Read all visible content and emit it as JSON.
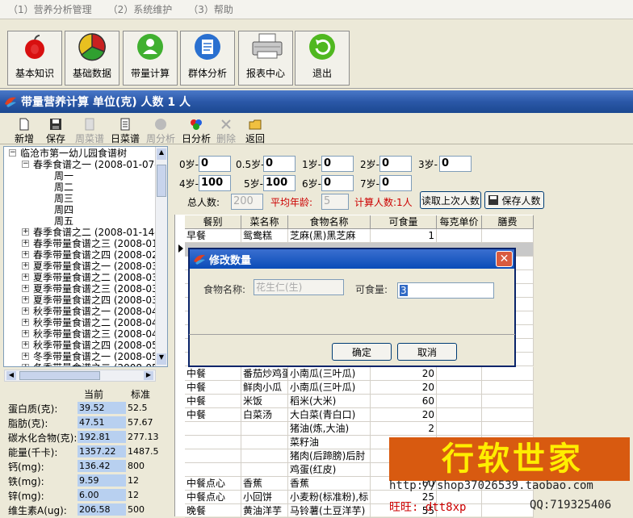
{
  "menu": [
    "（1）营养分析管理",
    "（2）系统维护",
    "（3）帮助"
  ],
  "big_toolbar": [
    {
      "label": "基本知识",
      "icon": "apple-icon"
    },
    {
      "label": "基础数据",
      "icon": "pie-chart-icon"
    },
    {
      "label": "带量计算",
      "icon": "user-icon"
    },
    {
      "label": "群体分析",
      "icon": "document-icon"
    },
    {
      "label": "报表中心",
      "icon": "printer-icon"
    },
    {
      "label": "退出",
      "icon": "refresh-exit-icon"
    }
  ],
  "window_title": "带量营养计算  单位(克)  人数 1 人",
  "small_toolbar": [
    {
      "label": "新增",
      "enabled": true
    },
    {
      "label": "保存",
      "enabled": true
    },
    {
      "label": "周菜谱",
      "enabled": false
    },
    {
      "label": "日菜谱",
      "enabled": true
    },
    {
      "label": "周分析",
      "enabled": false
    },
    {
      "label": "日分析",
      "enabled": true
    },
    {
      "label": "删除",
      "enabled": false
    },
    {
      "label": "返回",
      "enabled": true
    }
  ],
  "tree": {
    "root": "临沧市第一幼儿园食谱树",
    "expanded": "春季食谱之一 (2008-01-07-",
    "days": [
      "周一",
      "周二",
      "周三",
      "周四",
      "周五"
    ],
    "items": [
      "春季食谱之二 (2008-01-14-",
      "春季带量食谱之三 (2008-01",
      "春季带量食谱之四 (2008-02",
      "夏季带量食谱之一 (2008-03",
      "夏季带量食谱之二 (2008-03",
      "夏季带量食谱之三 (2008-03",
      "夏季带量食谱之四 (2008-03",
      "秋季带量食谱之一 (2008-04",
      "秋季带量食谱之二 (2008-04",
      "秋季带量食谱之三 (2008-04",
      "秋季带量食谱之四 (2008-05",
      "冬季带量食谱之一 (2008-05",
      "冬季带量食谱之二 (2008-05"
    ]
  },
  "nutrients": {
    "col_current": "当前",
    "col_standard": "标准",
    "rows": [
      {
        "name": "蛋白质(克):",
        "current": "39.52",
        "standard": "52.5"
      },
      {
        "name": "脂肪(克):",
        "current": "47.51",
        "standard": "57.67"
      },
      {
        "name": "碳水化合物(克):",
        "current": "192.81",
        "standard": "277.13"
      },
      {
        "name": "能量(千卡):",
        "current": "1357.22",
        "standard": "1487.5"
      },
      {
        "name": "钙(mg):",
        "current": "136.42",
        "standard": "800"
      },
      {
        "name": "铁(mg):",
        "current": "9.59",
        "standard": "12"
      },
      {
        "name": "锌(mg):",
        "current": "6.00",
        "standard": "12"
      },
      {
        "name": "维生素A(ug):",
        "current": "206.58",
        "standard": "500"
      }
    ]
  },
  "ages": {
    "row1": [
      {
        "label": "0岁-",
        "value": "0"
      },
      {
        "label": "0.5岁-",
        "value": "0"
      },
      {
        "label": "1岁-",
        "value": "0"
      },
      {
        "label": "2岁-",
        "value": "0"
      },
      {
        "label": "3岁-",
        "value": "0"
      }
    ],
    "row2": [
      {
        "label": "4岁-",
        "value": "100"
      },
      {
        "label": "5岁-",
        "value": "100"
      },
      {
        "label": "6岁-",
        "value": "0"
      },
      {
        "label": "7岁-",
        "value": "0"
      }
    ]
  },
  "summary": {
    "total_label": "总人数:",
    "total_value": "200",
    "avg_age_label": "平均年龄:",
    "avg_age_value": "5",
    "calc_label": "计算人数:1人",
    "read_button": "读取上次人数",
    "save_button": "保存人数"
  },
  "grid": {
    "headers": [
      "餐别",
      "菜名称",
      "食物名称",
      "可食量",
      "每克单价",
      "膳费"
    ],
    "rows_top": [
      {
        "meal": "早餐",
        "dish": "鸳鸯糕",
        "food": "芝麻(黑)黑芝麻",
        "amount": "1"
      }
    ],
    "rows_bottom": [
      {
        "meal": "中餐",
        "dish": "番茄炒鸡蛋",
        "food": "小南瓜(三叶瓜)",
        "amount": "20"
      },
      {
        "meal": "中餐",
        "dish": "鲜肉小瓜",
        "food": "小南瓜(三叶瓜)",
        "amount": "20"
      },
      {
        "meal": "中餐",
        "dish": "米饭",
        "food": "稻米(大米)",
        "amount": "60"
      },
      {
        "meal": "中餐",
        "dish": "白菜汤",
        "food": "大白菜(青白口)",
        "amount": "20"
      },
      {
        "meal": "",
        "dish": "",
        "food": "猪油(炼,大油)",
        "amount": "2"
      },
      {
        "meal": "",
        "dish": "",
        "food": "菜籽油",
        "amount": ""
      },
      {
        "meal": "",
        "dish": "",
        "food": "猪肉(后蹄膀)后肘",
        "amount": ""
      },
      {
        "meal": "",
        "dish": "",
        "food": "鸡蛋(红皮)",
        "amount": ""
      },
      {
        "meal": "中餐点心",
        "dish": "香蕉",
        "food": "香蕉",
        "amount": "60"
      },
      {
        "meal": "中餐点心",
        "dish": "小回饼",
        "food": "小麦粉(标准粉),标",
        "amount": "25"
      },
      {
        "meal": "晚餐",
        "dish": "黄油洋芋",
        "food": "马铃薯(土豆洋芋)",
        "amount": "55"
      }
    ]
  },
  "dialog": {
    "title": "修改数量",
    "food_label": "食物名称:",
    "food_value": "花生仁(生)",
    "amount_label": "可食量:",
    "amount_value": "3",
    "ok": "确定",
    "cancel": "取消"
  },
  "ad": {
    "banner": "行软世家",
    "url": "http://shop37026539.taobao.com",
    "wangwang": "旺旺:  dtt8xp",
    "qq": "QQ:719325406"
  },
  "colors": {
    "title_bar": "#2b58a8",
    "input_highlight": "#b8d0f0",
    "red_text": "#cc0000",
    "ad_background": "#d85a10",
    "ad_text": "#ffee00"
  }
}
